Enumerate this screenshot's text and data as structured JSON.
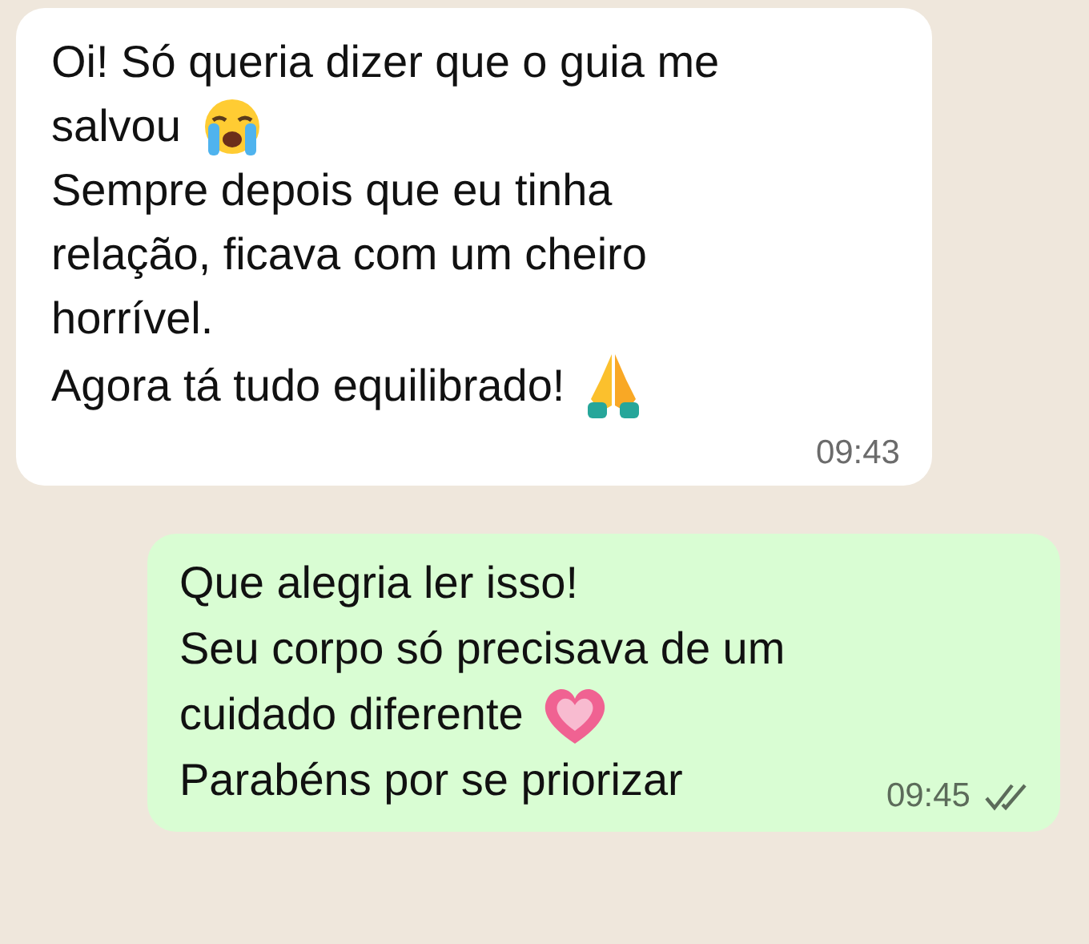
{
  "messages": [
    {
      "kind": "incoming",
      "lines": [
        {
          "text": "Oi! Só queria dizer que o guia me",
          "kind": "plain"
        },
        {
          "text": "salvou",
          "kind": "crying"
        },
        {
          "text": "Sempre depois que eu tinha",
          "kind": "plain"
        },
        {
          "text": "relação, ficava com um cheiro",
          "kind": "plain"
        },
        {
          "text": "horrível.",
          "kind": "plain"
        },
        {
          "text": "Agora tá tudo equilibrado!",
          "kind": "pray"
        }
      ],
      "time": "09:43"
    },
    {
      "kind": "outgoing",
      "lines": [
        {
          "text": "Que alegria ler isso!",
          "kind": "plain"
        },
        {
          "text": "Seu corpo só precisava de um",
          "kind": "plain"
        },
        {
          "text": "cuidado diferente",
          "kind": "heart"
        },
        {
          "text": "Parabéns por se priorizar",
          "kind": "plain"
        }
      ],
      "time": "09:45",
      "read": false
    }
  ]
}
